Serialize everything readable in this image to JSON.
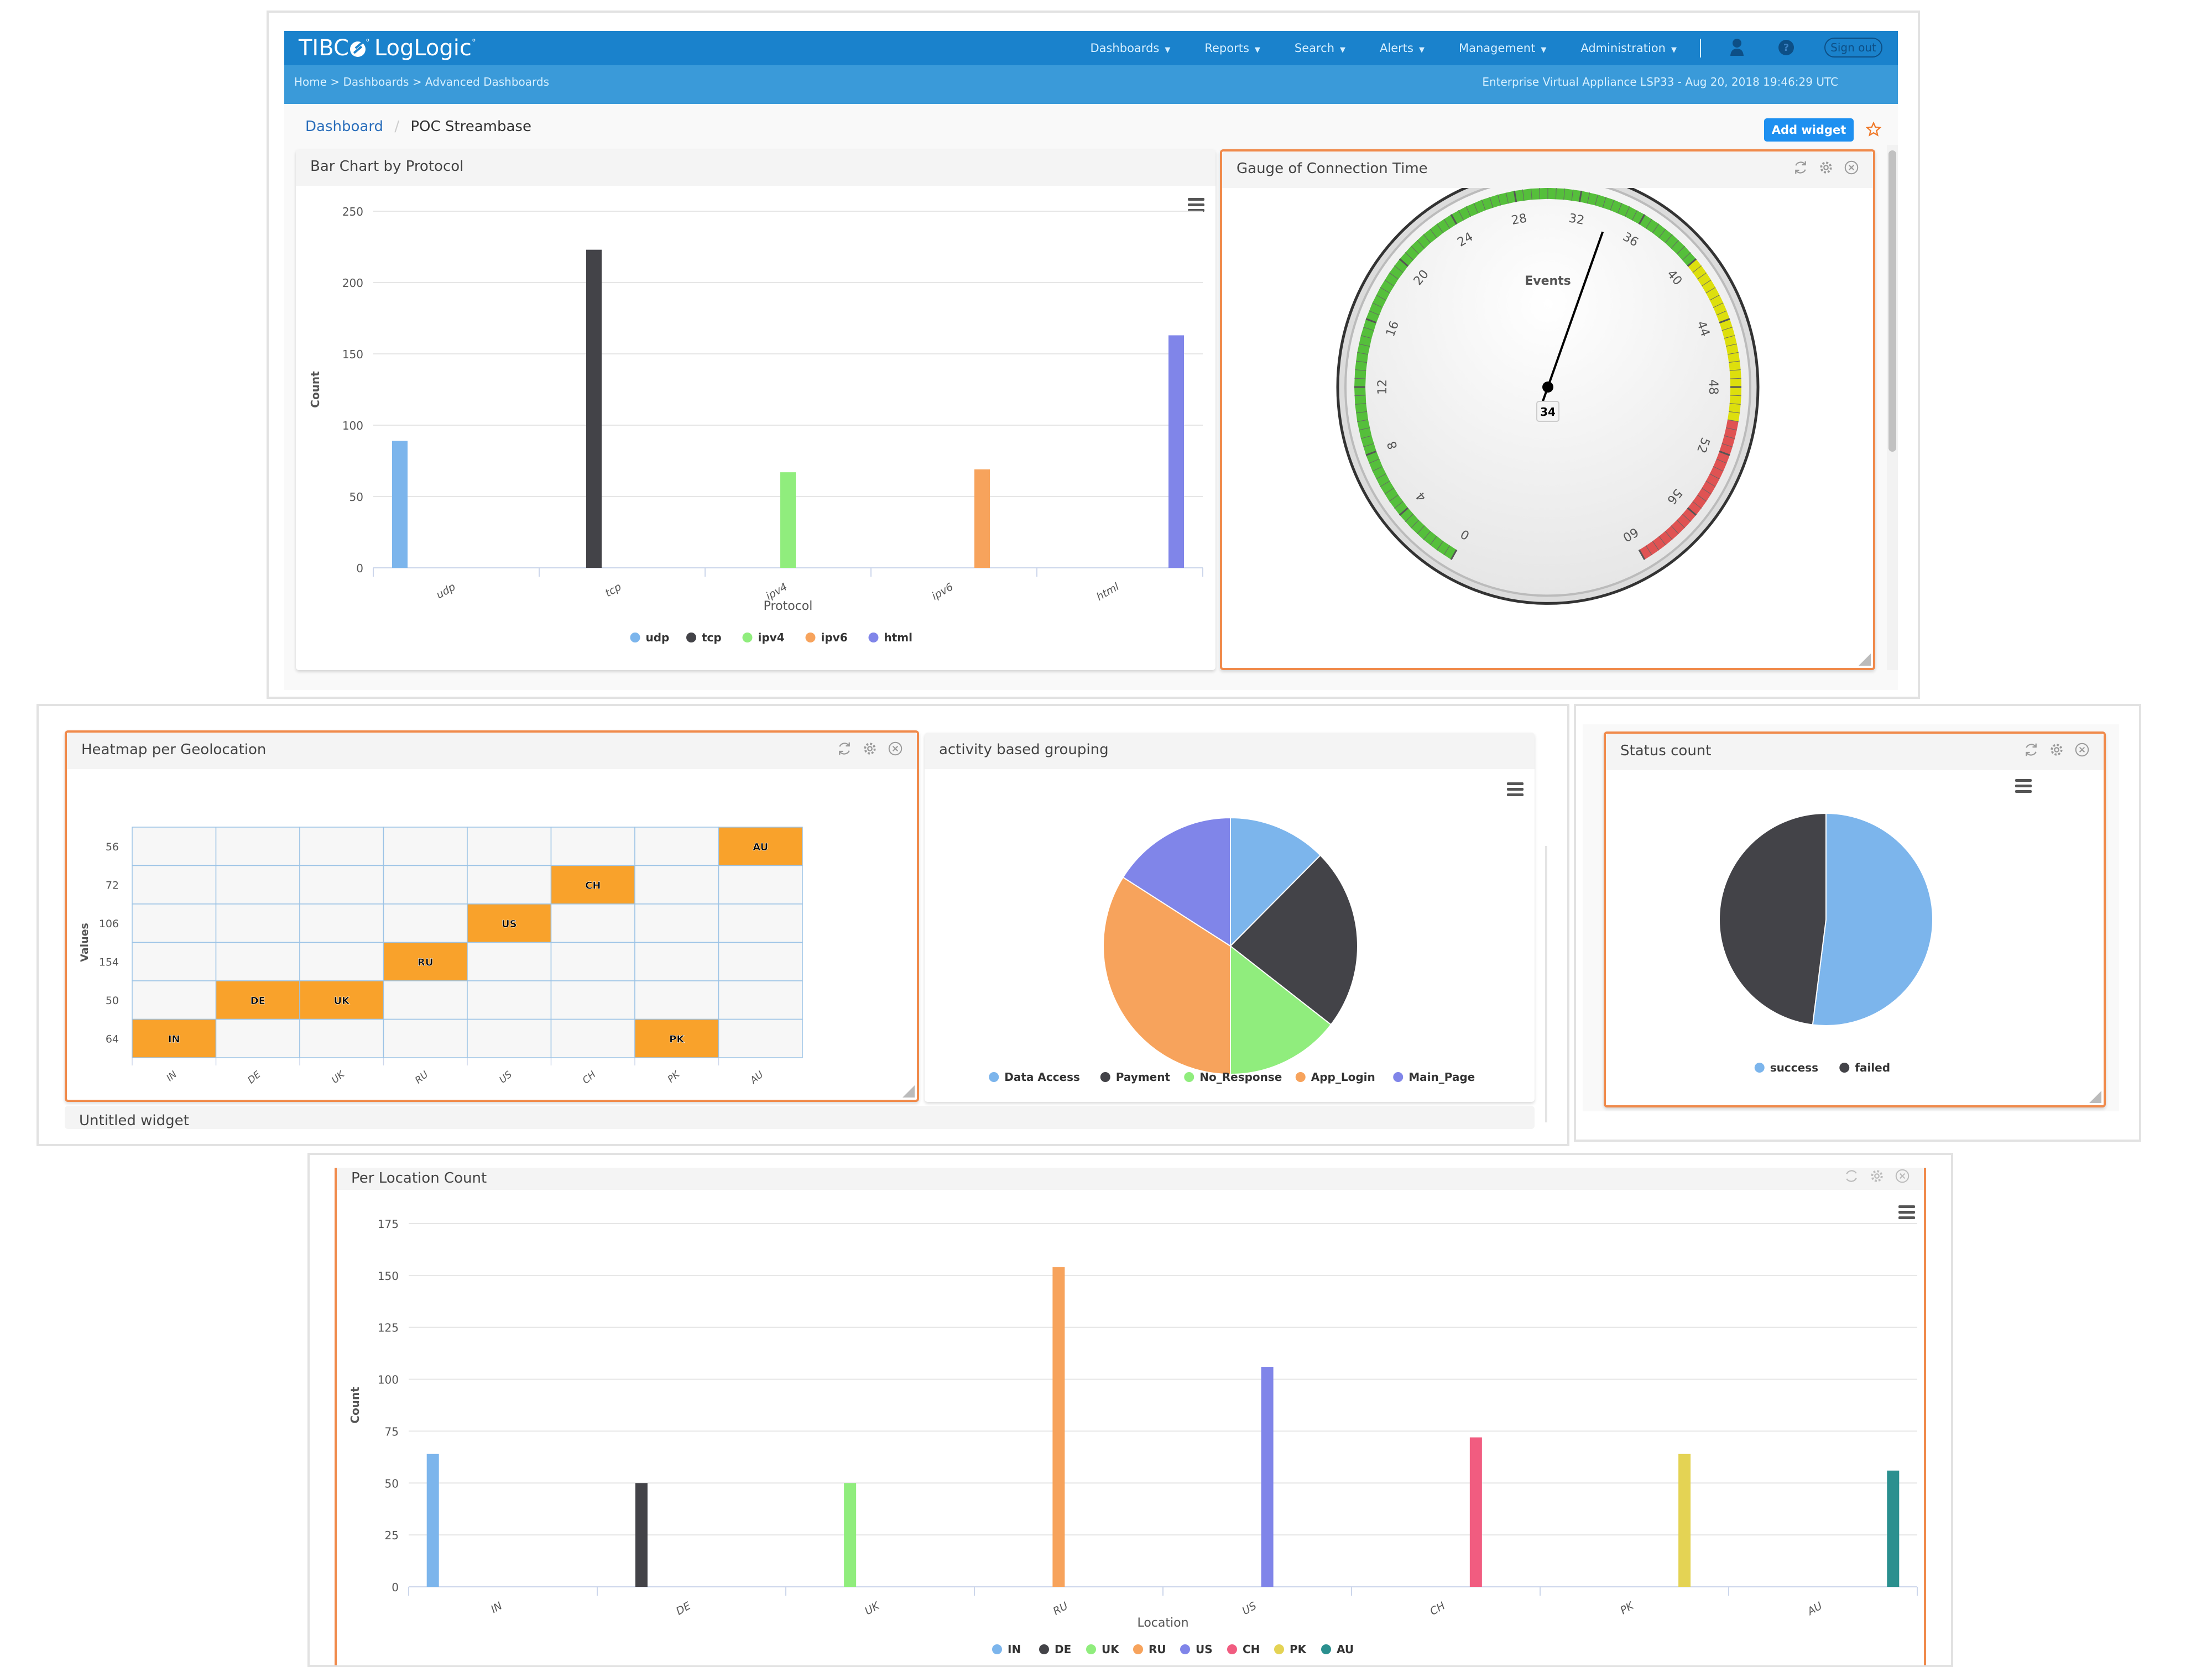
{
  "app": {
    "logo": "TIBCO LogLogic",
    "logo_tibco": "TIBC",
    "logo_product": "LogLogic",
    "nav": [
      {
        "label": "Dashboards"
      },
      {
        "label": "Reports"
      },
      {
        "label": "Search"
      },
      {
        "label": "Alerts"
      },
      {
        "label": "Management"
      },
      {
        "label": "Administration"
      }
    ],
    "user_icon": "user-icon",
    "help_icon": "help-icon",
    "sign_out": "Sign out",
    "breadcrumb": "Home > Dashboards > Advanced Dashboards",
    "appliance_info": "Enterprise Virtual Appliance LSP33 - Aug 20, 2018 19:46:29 UTC",
    "colors": {
      "header": "#1a82cc",
      "subheader": "#3a9ad9",
      "accent": "#f08a4b",
      "button": "#1e90f0"
    }
  },
  "page": {
    "crumb_link": "Dashboard",
    "crumb_sep": "/",
    "crumb_current": "POC Streambase",
    "add_widget": "Add widget",
    "favorite_icon": "star-icon"
  },
  "widgets": {
    "bar_protocol": {
      "title": "Bar Chart by Protocol"
    },
    "gauge": {
      "title": "Gauge of Connection Time"
    },
    "heatmap": {
      "title": "Heatmap per Geolocation"
    },
    "activity": {
      "title": "activity based grouping"
    },
    "untitled": {
      "title": "Untitled widget"
    },
    "status": {
      "title": "Status count"
    },
    "location": {
      "title": "Per Location Count"
    }
  },
  "chart_data": [
    {
      "id": "bar_protocol",
      "type": "bar",
      "title": "Bar Chart by Protocol",
      "xlabel": "Protocol",
      "ylabel": "Count",
      "categories": [
        "udp",
        "tcp",
        "ipv4",
        "ipv6",
        "html"
      ],
      "values": [
        89,
        223,
        67,
        69,
        163
      ],
      "colors": [
        "#7cb5ec",
        "#434348",
        "#90ed7d",
        "#f7a35c",
        "#8085e9"
      ],
      "ylim": [
        0,
        250
      ],
      "yticks": [
        0,
        50,
        100,
        150,
        200,
        250
      ],
      "grid": true,
      "legend": "bottom"
    },
    {
      "id": "gauge",
      "type": "gauge",
      "title": "Gauge of Connection Time",
      "label": "Events",
      "value": 34,
      "range": [
        0,
        60
      ],
      "ticks": [
        0,
        4,
        8,
        12,
        16,
        20,
        24,
        28,
        32,
        36,
        40,
        44,
        48,
        52,
        56,
        60
      ],
      "bands": [
        {
          "from": 0,
          "to": 40,
          "color": "#55bf3b"
        },
        {
          "from": 40,
          "to": 50,
          "color": "#dddf0d"
        },
        {
          "from": 50,
          "to": 60,
          "color": "#df5353"
        }
      ]
    },
    {
      "id": "heatmap",
      "type": "heatmap",
      "title": "Heatmap per Geolocation",
      "ylabel": "Values",
      "xcategories": [
        "IN",
        "DE",
        "UK",
        "RU",
        "US",
        "CH",
        "PK",
        "AU"
      ],
      "ycategories": [
        "56",
        "72",
        "106",
        "154",
        "50",
        "64"
      ],
      "cells": [
        {
          "x": "IN",
          "y": "64",
          "label": "IN"
        },
        {
          "x": "DE",
          "y": "50",
          "label": "DE"
        },
        {
          "x": "UK",
          "y": "50",
          "label": "UK"
        },
        {
          "x": "RU",
          "y": "154",
          "label": "RU"
        },
        {
          "x": "US",
          "y": "106",
          "label": "US"
        },
        {
          "x": "CH",
          "y": "72",
          "label": "CH"
        },
        {
          "x": "PK",
          "y": "64",
          "label": "PK"
        },
        {
          "x": "AU",
          "y": "56",
          "label": "AU"
        }
      ],
      "fill": "#f9a22b",
      "empty": "#f7f7f7"
    },
    {
      "id": "activity",
      "type": "pie",
      "title": "activity based grouping",
      "labels": [
        "Data Access",
        "Payment",
        "No_Response",
        "App_Login",
        "Main_Page"
      ],
      "values": [
        12.5,
        23,
        14.5,
        34,
        16
      ],
      "colors": [
        "#7cb5ec",
        "#434348",
        "#90ed7d",
        "#f7a35c",
        "#8085e9"
      ],
      "legend": "bottom"
    },
    {
      "id": "status",
      "type": "pie",
      "title": "Status count",
      "labels": [
        "success",
        "failed"
      ],
      "values": [
        52,
        48
      ],
      "colors": [
        "#7cb5ec",
        "#434348"
      ],
      "legend": "bottom"
    },
    {
      "id": "location",
      "type": "bar",
      "title": "Per Location Count",
      "xlabel": "Location",
      "ylabel": "Count",
      "categories": [
        "IN",
        "DE",
        "UK",
        "RU",
        "US",
        "CH",
        "PK",
        "AU"
      ],
      "values": [
        64,
        50,
        50,
        154,
        106,
        72,
        64,
        56
      ],
      "colors": [
        "#7cb5ec",
        "#434348",
        "#90ed7d",
        "#f7a35c",
        "#8085e9",
        "#f15c80",
        "#e4d354",
        "#2b908f"
      ],
      "ylim": [
        0,
        175
      ],
      "yticks": [
        0,
        25,
        50,
        75,
        100,
        125,
        150,
        175
      ],
      "grid": true,
      "legend": "bottom"
    }
  ]
}
